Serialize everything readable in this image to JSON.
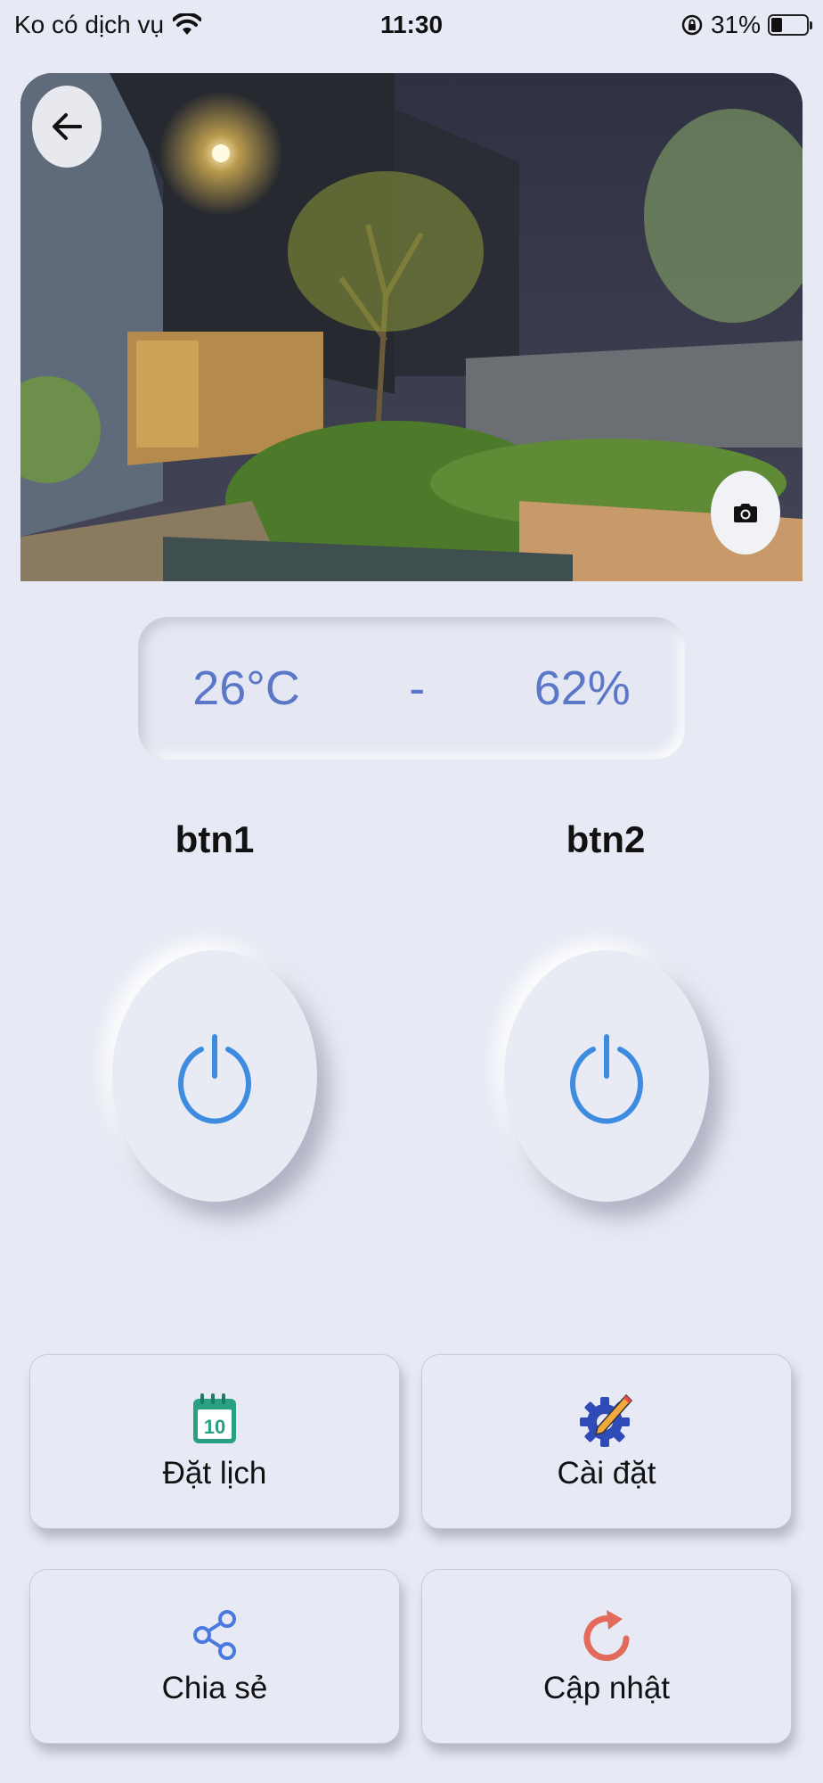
{
  "status_bar": {
    "carrier": "Ko có dịch vụ",
    "time": "11:30",
    "battery": "31%",
    "battery_level": 0.31
  },
  "camera": {
    "back_icon": "arrow-left-icon",
    "snapshot_icon": "camera-icon"
  },
  "sensor": {
    "temperature": "26°C",
    "separator": "-",
    "humidity": "62%"
  },
  "buttons": [
    {
      "label": "btn1",
      "icon": "power-icon"
    },
    {
      "label": "btn2",
      "icon": "power-icon"
    }
  ],
  "actions": [
    {
      "label": "Đặt lịch",
      "icon": "calendar-icon",
      "icon_text": "10"
    },
    {
      "label": "Cài đặt",
      "icon": "settings-gear-icon"
    },
    {
      "label": "Chia sẻ",
      "icon": "share-icon"
    },
    {
      "label": "Cập nhật",
      "icon": "refresh-icon"
    }
  ],
  "colors": {
    "background": "#e7eaf4",
    "accent_text": "#5a77c8",
    "power_icon": "#3d8ce0"
  }
}
